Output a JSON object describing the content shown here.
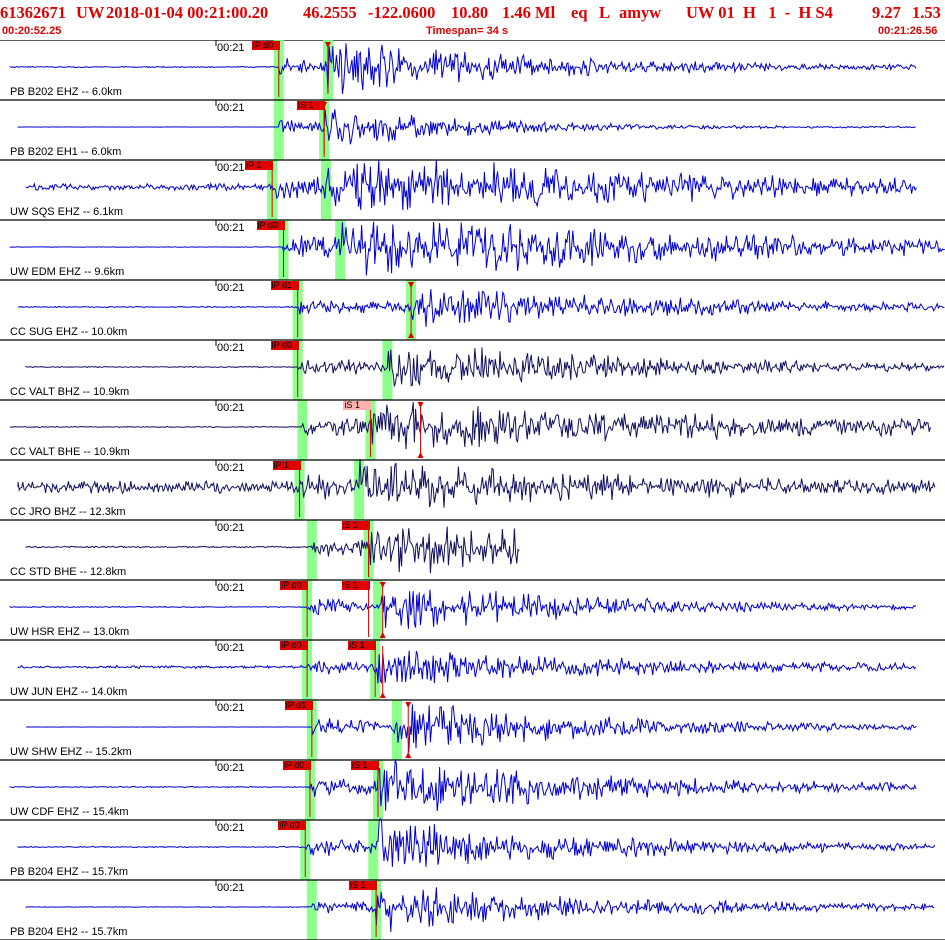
{
  "header": {
    "event_id": "61362671",
    "network": "UW",
    "origin_time": "2018-01-04 00:21:00.20",
    "latitude": "46.2555",
    "longitude": "-122.0600",
    "depth": "10.80",
    "magnitude": "1.46 Ml",
    "event_type": "eq",
    "local_flag": "L",
    "author": "amyw",
    "quality": "UW 01  H   1  -  H S4",
    "extra1": "9.27",
    "extra2": "1.53",
    "start_time": "00:20:52.25",
    "timespan_label": "Timespan=  34 s",
    "end_time": "00:21:26.56"
  },
  "colors": {
    "header_text": "#e00000",
    "trace_blue": "#0000d0",
    "trace_dark": "#101060",
    "pick_box": "#e00000",
    "pick_box_light": "#ffb0b0",
    "arrival_band": "#7fff7f",
    "separator": "#000000"
  },
  "traces": [
    {
      "label": "PB B202 EHZ -- 6.0km",
      "time": "00:21",
      "picks": [
        {
          "text": "iP d0",
          "pos": 0.295
        },
        {
          "text": "",
          "pos": 0.347,
          "marker": "down"
        }
      ],
      "color": "blue",
      "amp": 0.8,
      "onset": 0.295,
      "s": 0.347,
      "end": 0.97,
      "decay": 0.25,
      "noise": 0.02
    },
    {
      "label": "PB B202 EH1 -- 6.0km",
      "time": "00:21",
      "picks": [
        {
          "text": "iS 1",
          "pos": 0.343,
          "marker": "down"
        }
      ],
      "color": "blue",
      "amp": 0.55,
      "onset": 0.295,
      "s": 0.343,
      "end": 0.97,
      "decay": 0.2,
      "noise": 0.005
    },
    {
      "label": "UW SQS EHZ -- 6.1km",
      "time": "00:21",
      "picks": [
        {
          "text": "iP 1",
          "pos": 0.288
        }
      ],
      "color": "blue",
      "amp": 1.0,
      "onset": 0.288,
      "s": 0.345,
      "end": 0.97,
      "decay": 0.35,
      "noise": 0.12
    },
    {
      "label": "UW EDM EHZ -- 9.6km",
      "time": "00:21",
      "picks": [
        {
          "text": "iP d0",
          "pos": 0.3
        }
      ],
      "color": "blue",
      "amp": 1.0,
      "onset": 0.3,
      "s": 0.36,
      "end": 1.0,
      "decay": 0.45,
      "noise": 0.01
    },
    {
      "label": "CC SUG EHZ -- 10.0km",
      "time": "00:21",
      "picks": [
        {
          "text": "iP d1",
          "pos": 0.315
        },
        {
          "text": "",
          "pos": 0.435,
          "marker": "both"
        }
      ],
      "color": "blue",
      "amp": 0.6,
      "onset": 0.315,
      "s": 0.435,
      "end": 1.0,
      "decay": 0.35,
      "noise": 0.02
    },
    {
      "label": "CC VALT BHZ -- 10.9km",
      "time": "00:21",
      "picks": [
        {
          "text": "iP d0",
          "pos": 0.315
        }
      ],
      "color": "dark",
      "amp": 0.75,
      "onset": 0.315,
      "s": 0.41,
      "end": 1.0,
      "decay": 0.3,
      "noise": 0.02
    },
    {
      "label": "CC VALT BHE -- 10.9km",
      "time": "00:21",
      "picks": [
        {
          "text": "iS 1",
          "pos": 0.392,
          "light": true
        },
        {
          "text": "",
          "pos": 0.445,
          "marker": "both"
        }
      ],
      "color": "dark",
      "amp": 0.75,
      "onset": 0.32,
      "s": 0.392,
      "end": 0.985,
      "decay": 0.5,
      "noise": 0.02
    },
    {
      "label": "CC JRO BHZ -- 12.3km",
      "time": "00:21",
      "picks": [
        {
          "text": "iP 1",
          "pos": 0.317
        }
      ],
      "color": "dark",
      "amp": 0.6,
      "onset": 0.317,
      "s": 0.38,
      "end": 0.99,
      "decay": 0.25,
      "noise": 0.22
    },
    {
      "label": "CC STD BHE -- 12.8km",
      "time": "00:21",
      "picks": [
        {
          "text": "iS 1",
          "pos": 0.39
        }
      ],
      "color": "dark",
      "amp": 0.8,
      "onset": 0.33,
      "s": 0.39,
      "end": 0.55,
      "decay": 0.35,
      "noise": 0.03
    },
    {
      "label": "UW HSR EHZ -- 13.0km",
      "time": "00:21",
      "picks": [
        {
          "text": "iP d0",
          "pos": 0.325
        },
        {
          "text": "iS 1",
          "pos": 0.39
        },
        {
          "text": "",
          "pos": 0.405,
          "marker": "both"
        }
      ],
      "color": "blue",
      "amp": 0.75,
      "onset": 0.325,
      "s": 0.4,
      "end": 0.97,
      "decay": 0.25,
      "noise": 0.02
    },
    {
      "label": "UW JUN EHZ -- 14.0km",
      "time": "00:21",
      "picks": [
        {
          "text": "iP d0",
          "pos": 0.325
        },
        {
          "text": "iS 1",
          "pos": 0.397
        },
        {
          "text": "",
          "pos": 0.405,
          "marker": "up"
        }
      ],
      "color": "blue",
      "amp": 0.55,
      "onset": 0.325,
      "s": 0.397,
      "end": 0.97,
      "decay": 0.3,
      "noise": 0.05
    },
    {
      "label": "UW SHW EHZ -- 15.2km",
      "time": "00:21",
      "picks": [
        {
          "text": "iP d1",
          "pos": 0.33
        },
        {
          "text": "",
          "pos": 0.432,
          "marker": "both"
        }
      ],
      "color": "blue",
      "amp": 0.8,
      "onset": 0.33,
      "s": 0.42,
      "end": 0.97,
      "decay": 0.25,
      "noise": 0.005
    },
    {
      "label": "UW CDF EHZ -- 15.4km",
      "time": "00:21",
      "picks": [
        {
          "text": "iP d0",
          "pos": 0.328
        },
        {
          "text": "iS 1",
          "pos": 0.4
        }
      ],
      "color": "blue",
      "amp": 0.8,
      "onset": 0.328,
      "s": 0.4,
      "end": 0.97,
      "decay": 0.3,
      "noise": 0.02
    },
    {
      "label": "PB B204 EHZ -- 15.7km",
      "time": "00:21",
      "picks": [
        {
          "text": "iP d0",
          "pos": 0.323
        }
      ],
      "color": "blue",
      "amp": 0.75,
      "onset": 0.323,
      "s": 0.395,
      "end": 0.99,
      "decay": 0.3,
      "noise": 0.02
    },
    {
      "label": "PB B204 EH2 -- 15.7km",
      "time": "00:21",
      "picks": [
        {
          "text": "iS 1",
          "pos": 0.398
        }
      ],
      "color": "blue",
      "amp": 0.7,
      "onset": 0.33,
      "s": 0.398,
      "end": 0.99,
      "decay": 0.3,
      "noise": 0.01
    }
  ]
}
